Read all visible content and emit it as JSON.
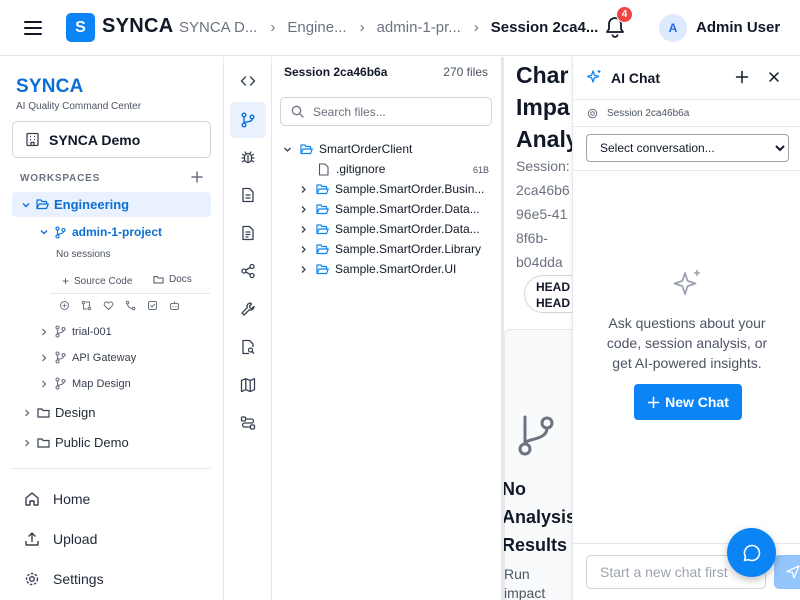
{
  "header": {
    "logo_letter": "S",
    "app_name": "SYNCA",
    "breadcrumbs": [
      "SYNCA D...",
      "Engine...",
      "admin-1-pr...",
      "Session 2ca4..."
    ],
    "notification_count": "4",
    "avatar_initial": "A",
    "user_name": "Admin User"
  },
  "sidebar": {
    "brand": "SYNCA",
    "tagline": "AI Quality Command Center",
    "org_name": "SYNCA Demo",
    "workspaces_label": "WORKSPACES",
    "tree": {
      "engineering": "Engineering",
      "project": "admin-1-project",
      "no_sessions": "No sessions",
      "source_code": "Source Code",
      "docs": "Docs",
      "subprojects": [
        "trial-001",
        "API Gateway",
        "Map Design"
      ],
      "workspaces": [
        "Design",
        "Public Demo"
      ]
    },
    "nav": [
      "Home",
      "Upload",
      "Settings"
    ]
  },
  "files": {
    "title": "Session 2ca46b6a",
    "count": "270 files",
    "search_placeholder": "Search files...",
    "root": "SmartOrderClient",
    "items": [
      {
        "name": ".gitignore",
        "size": "61B"
      },
      {
        "name": "Sample.SmartOrder.Busin..."
      },
      {
        "name": "Sample.SmartOrder.Data..."
      },
      {
        "name": "Sample.SmartOrder.Data..."
      },
      {
        "name": "Sample.SmartOrder.Library"
      },
      {
        "name": "Sample.SmartOrder.UI"
      }
    ]
  },
  "main": {
    "title_lines": [
      "Char",
      "Impa",
      "Analy"
    ],
    "session_lines": [
      "Session:",
      "2ca46b6",
      "96e5-41",
      "8f6b-",
      "b04dda"
    ],
    "pill_lines": [
      "HEAD",
      "HEAD"
    ],
    "no_results_lines": [
      "No",
      "Analysis",
      "Results"
    ],
    "run_lines": [
      "Run",
      "impact"
    ]
  },
  "chat": {
    "title": "AI Chat",
    "session_label": "Session 2ca46b6a",
    "select_value": "Select conversation...",
    "empty_text": "Ask questions about your code, session analysis, or get AI-powered insights.",
    "new_chat_label": "New Chat",
    "input_placeholder": "Start a new chat first"
  },
  "colors": {
    "accent": "#0b84f5",
    "brand_text": "#0b6fd6",
    "active_bg": "#e8f1fd",
    "badge": "#ef4444"
  }
}
